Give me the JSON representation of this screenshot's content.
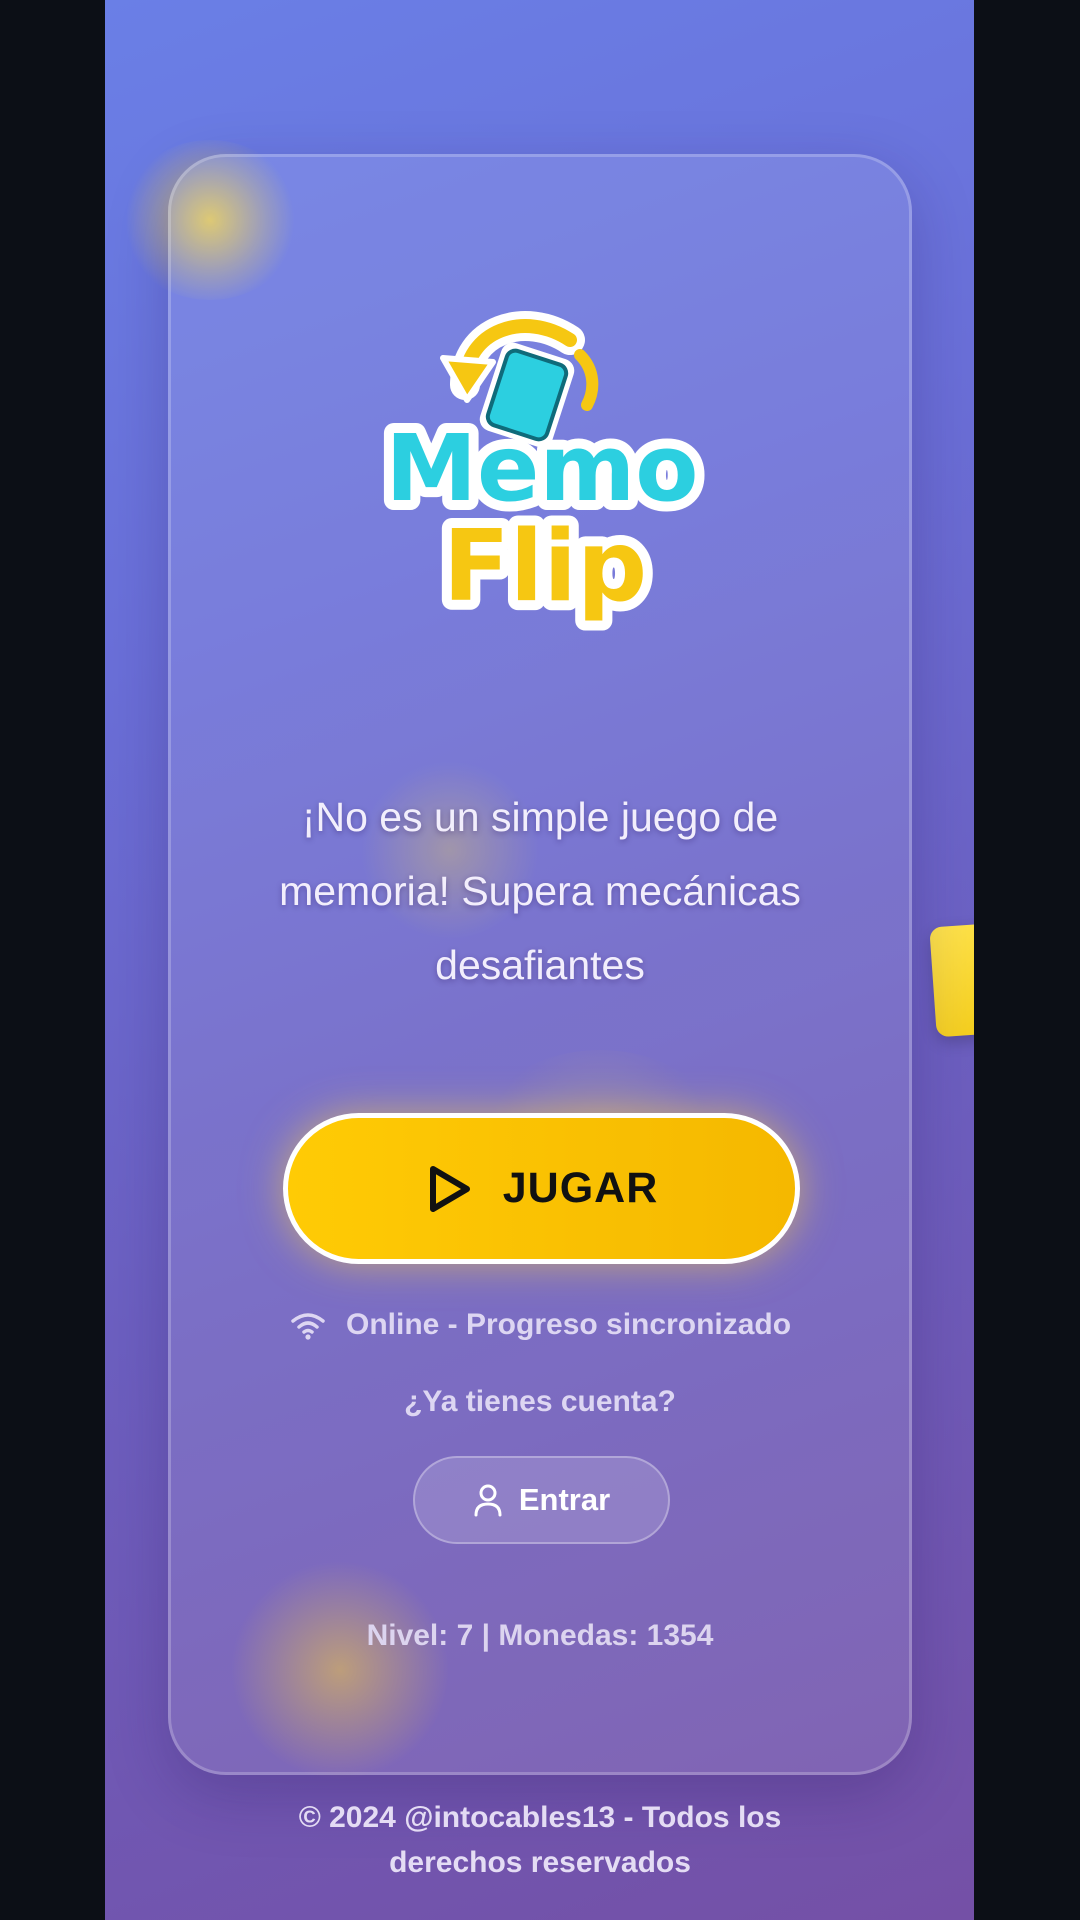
{
  "logo": {
    "line1": "Memo",
    "line2": "Flip",
    "icon": "flip-card-arrow-icon"
  },
  "tagline": "¡No es un simple juego de memoria! Supera mecánicas desafiantes",
  "play_button": {
    "label": "JUGAR",
    "icon": "play-icon"
  },
  "status": {
    "icon": "wifi-icon",
    "text": "Online - Progreso sincronizado"
  },
  "account": {
    "question": "¿Ya tienes cuenta?",
    "login_label": "Entrar",
    "login_icon": "user-icon"
  },
  "stats": "Nivel: 7 | Monedas: 1354",
  "footer": "© 2024 @intocables13 - Todos los derechos reservados",
  "colors": {
    "accent": "#ffcb05",
    "logo_teal": "#2ccfe0",
    "logo_yellow": "#f6c712",
    "background_top": "#6a7fe6",
    "background_bottom": "#7450a6"
  }
}
